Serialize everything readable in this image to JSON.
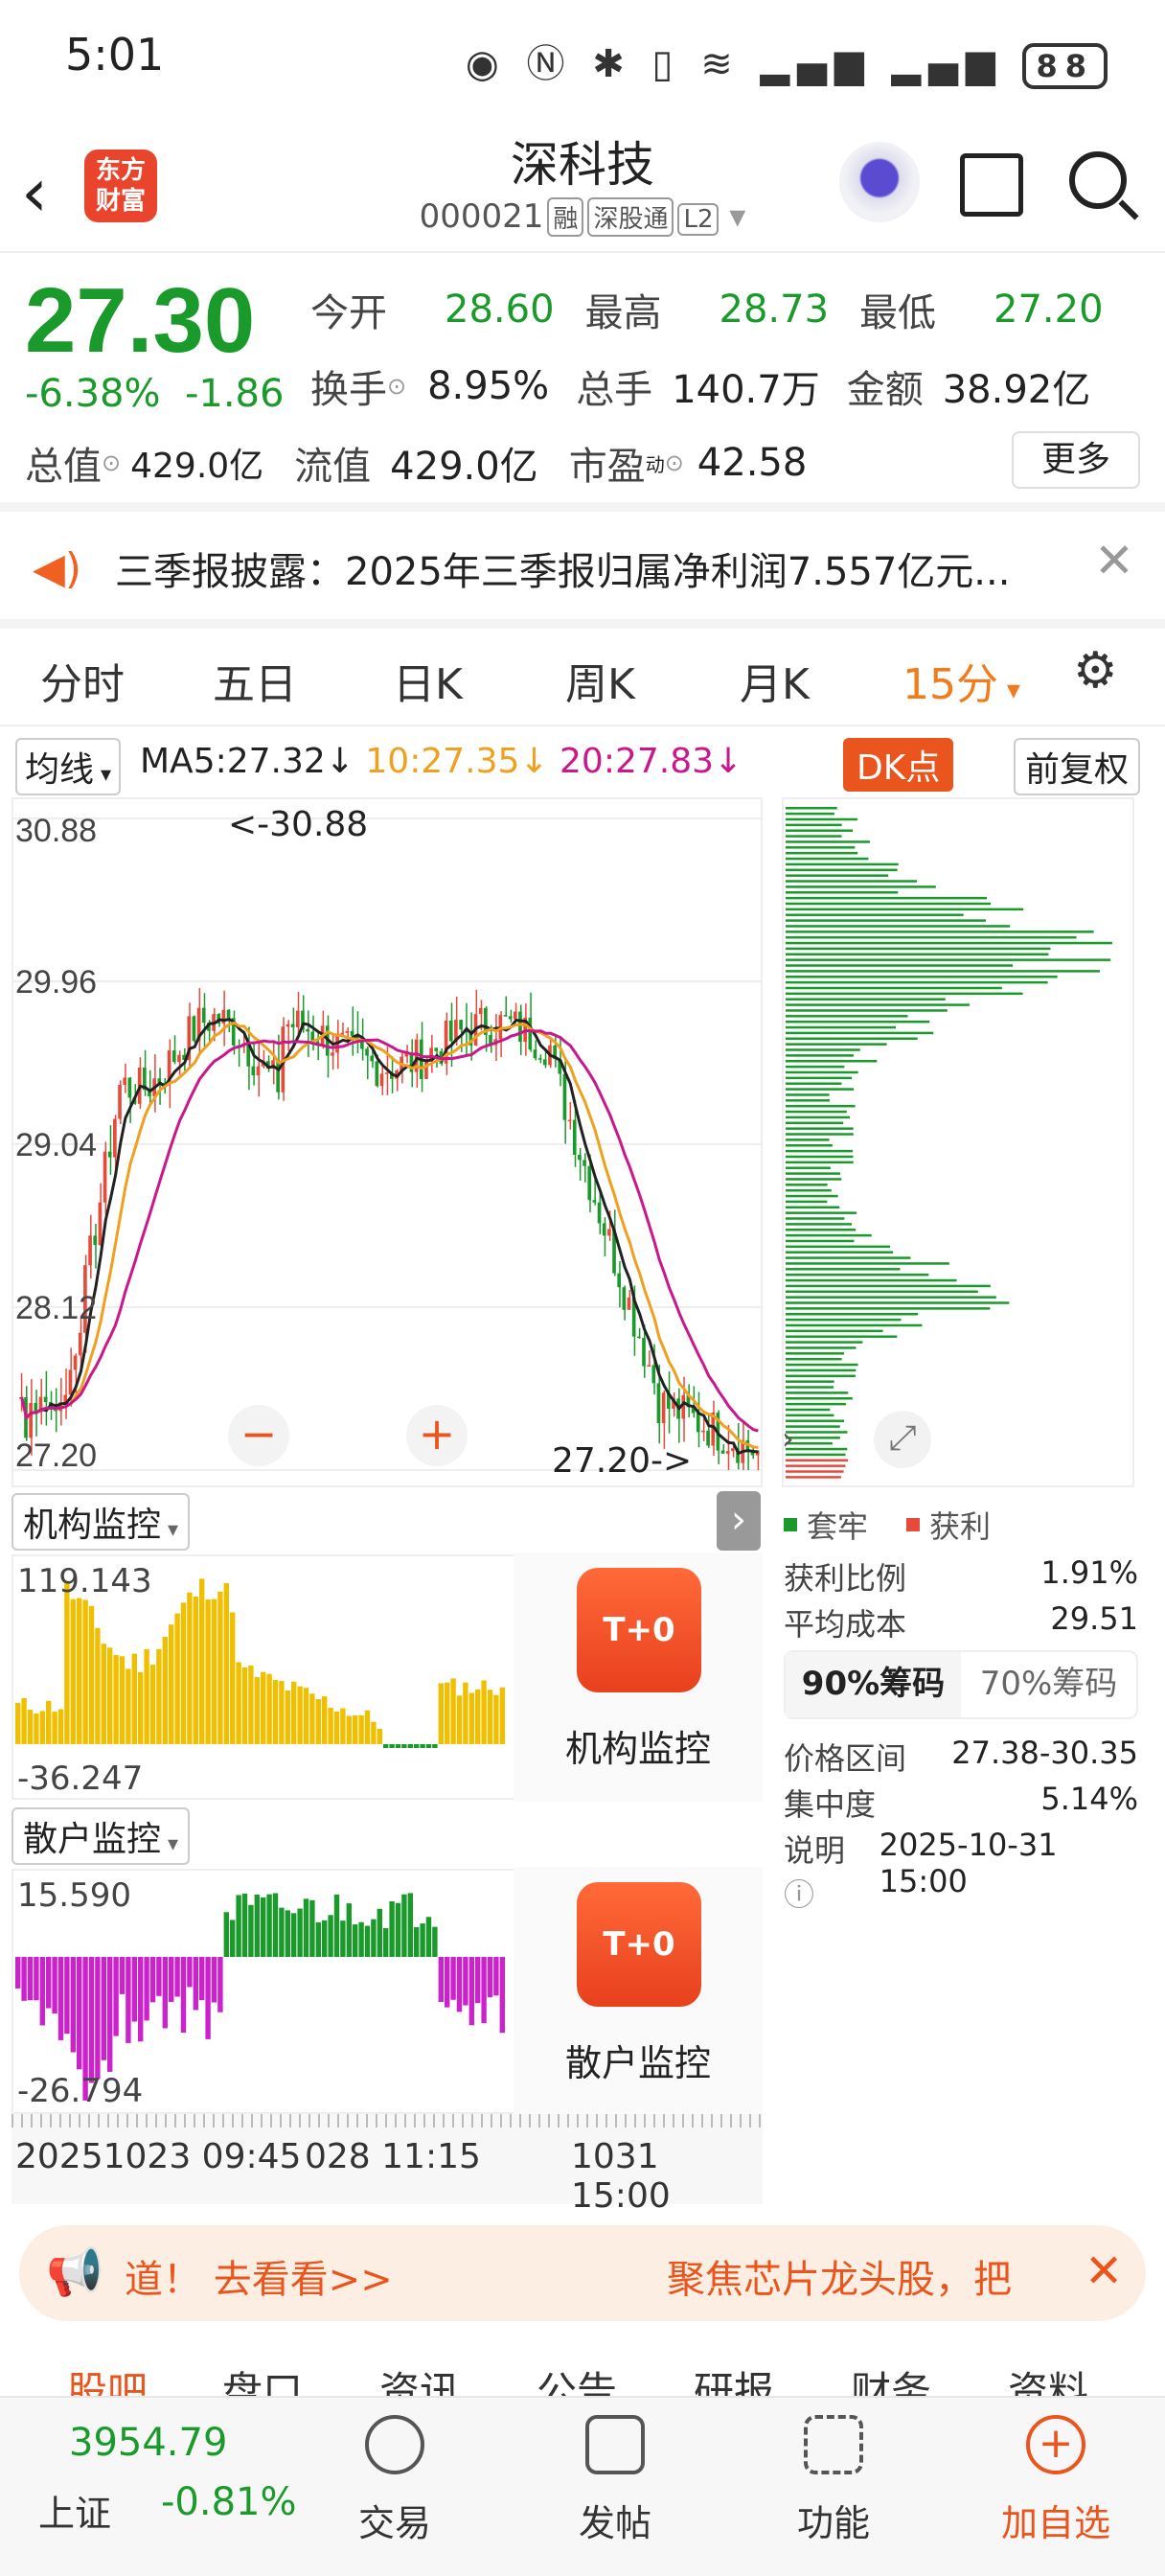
{
  "status_bar": {
    "time": "5:01",
    "battery": "88"
  },
  "header": {
    "back": "‹",
    "logo": "东方\n财富",
    "stock_name": "深科技",
    "code": "000021",
    "tags": [
      "融",
      "深股通",
      "L2"
    ]
  },
  "quote": {
    "price": "27.30",
    "change_pct": "-6.38%",
    "change": "-1.86",
    "open_label": "今开",
    "open": "28.60",
    "high_label": "最高",
    "high": "28.73",
    "low_label": "最低",
    "low": "27.20",
    "turnover_label": "换手",
    "turnover": "8.95%",
    "volume_label": "总手",
    "volume": "140.7万",
    "amount_label": "金额",
    "amount": "38.92亿",
    "mcap_label": "总值",
    "mcap": "429.0亿",
    "float_label": "流值",
    "float": "429.0亿",
    "pe_label": "市盈",
    "pe_sup": "动",
    "pe": "42.58",
    "more": "更多"
  },
  "news": {
    "text": "三季报披露：2025年三季报归属净利润7.557亿元..."
  },
  "period_tabs": [
    "分时",
    "五日",
    "日K",
    "周K",
    "月K",
    "15分"
  ],
  "ma": {
    "selector": "均线",
    "ma5": "MA5:27.32",
    "ma10": "10:27.35",
    "ma20": "20:27.83",
    "dk": "DK点",
    "adjust": "前复权"
  },
  "kchart": {
    "y_labels": [
      "30.88",
      "29.96",
      "29.04",
      "28.12",
      "27.20"
    ],
    "high_marker": "<-30.88",
    "low_marker": "27.20->"
  },
  "chips": {
    "legend_trapped": "套牢",
    "legend_profit": "获利",
    "rows": [
      {
        "label": "获利比例",
        "value": "1.91%"
      },
      {
        "label": "平均成本",
        "value": "29.51"
      }
    ],
    "tabs": [
      "90%筹码",
      "70%筹码"
    ],
    "rows2": [
      {
        "label": "价格区间",
        "value": "27.38-30.35"
      },
      {
        "label": "集中度",
        "value": "5.14%"
      },
      {
        "label": "说明",
        "value": "2025-10-31 15:00"
      }
    ]
  },
  "inst_monitor": {
    "title": "机构监控",
    "max": "119.143",
    "min": "-36.247",
    "card": "机构监控",
    "icon": "T+0"
  },
  "retail_monitor": {
    "title": "散户监控",
    "max": "15.590",
    "min": "-26.794",
    "card": "散户监控",
    "icon": "T+0"
  },
  "time_axis": {
    "left": "20251023 09:45",
    "mid": "028 11:15",
    "right": "1031 15:00"
  },
  "banner": {
    "left": "道！ 去看看>>",
    "right": "聚焦芯片龙头股，把"
  },
  "sub_tabs": [
    "股吧",
    "盘口",
    "资讯",
    "公告",
    "研报",
    "财务",
    "资料"
  ],
  "bottom_bar": {
    "index_value": "3954.79",
    "index_name": "上证",
    "index_change": "-0.81%",
    "items": [
      "交易",
      "发帖",
      "功能",
      "加自选"
    ]
  },
  "colors": {
    "up": "#e64a3a",
    "down": "#1a9a2b",
    "accent": "#e9551d",
    "inst_bar": "#f0c000",
    "retail_neg": "#cc22cc"
  }
}
